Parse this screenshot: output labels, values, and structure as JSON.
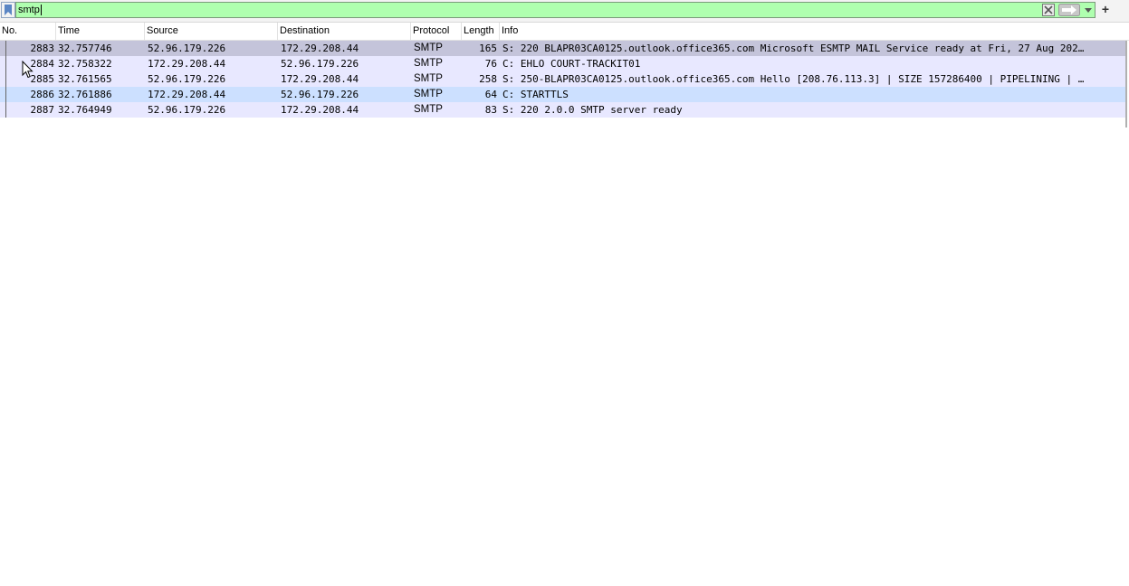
{
  "filter": {
    "value": "smtp",
    "background": "#afffaf"
  },
  "icons": {
    "bookmark": "bookmark-icon",
    "clear": "clear-filter-icon",
    "apply": "apply-filter-arrow-icon",
    "dropdown": "chevron-down-icon",
    "add": "plus-icon"
  },
  "add_button_label": "+",
  "columns": [
    "No.",
    "Time",
    "Source",
    "Destination",
    "Protocol",
    "Length",
    "Info"
  ],
  "rows": [
    {
      "no": "2883",
      "time": "32.757746",
      "source": "52.96.179.226",
      "destination": "172.29.208.44",
      "protocol": "SMTP",
      "length": "165",
      "info": "S: 220 BLAPR03CA0125.outlook.office365.com Microsoft ESMTP MAIL Service ready at Fri, 27 Aug 202…",
      "bg": "#c4c4da",
      "selected": true
    },
    {
      "no": "2884",
      "time": "32.758322",
      "source": "172.29.208.44",
      "destination": "52.96.179.226",
      "protocol": "SMTP",
      "length": "76",
      "info": "C: EHLO COURT-TRACKIT01",
      "bg": "#e8e8ff",
      "selected": false
    },
    {
      "no": "2885",
      "time": "32.761565",
      "source": "52.96.179.226",
      "destination": "172.29.208.44",
      "protocol": "SMTP",
      "length": "258",
      "info": "S: 250-BLAPR03CA0125.outlook.office365.com Hello [208.76.113.3] | SIZE 157286400 | PIPELINING | …",
      "bg": "#e8e8ff",
      "selected": false
    },
    {
      "no": "2886",
      "time": "32.761886",
      "source": "172.29.208.44",
      "destination": "52.96.179.226",
      "protocol": "SMTP",
      "length": "64",
      "info": "C: STARTTLS",
      "bg": "#cce0ff",
      "selected": false
    },
    {
      "no": "2887",
      "time": "32.764949",
      "source": "52.96.179.226",
      "destination": "172.29.208.44",
      "protocol": "SMTP",
      "length": "83",
      "info": "S: 220 2.0.0 SMTP server ready",
      "bg": "#e8e8ff",
      "selected": false
    }
  ]
}
